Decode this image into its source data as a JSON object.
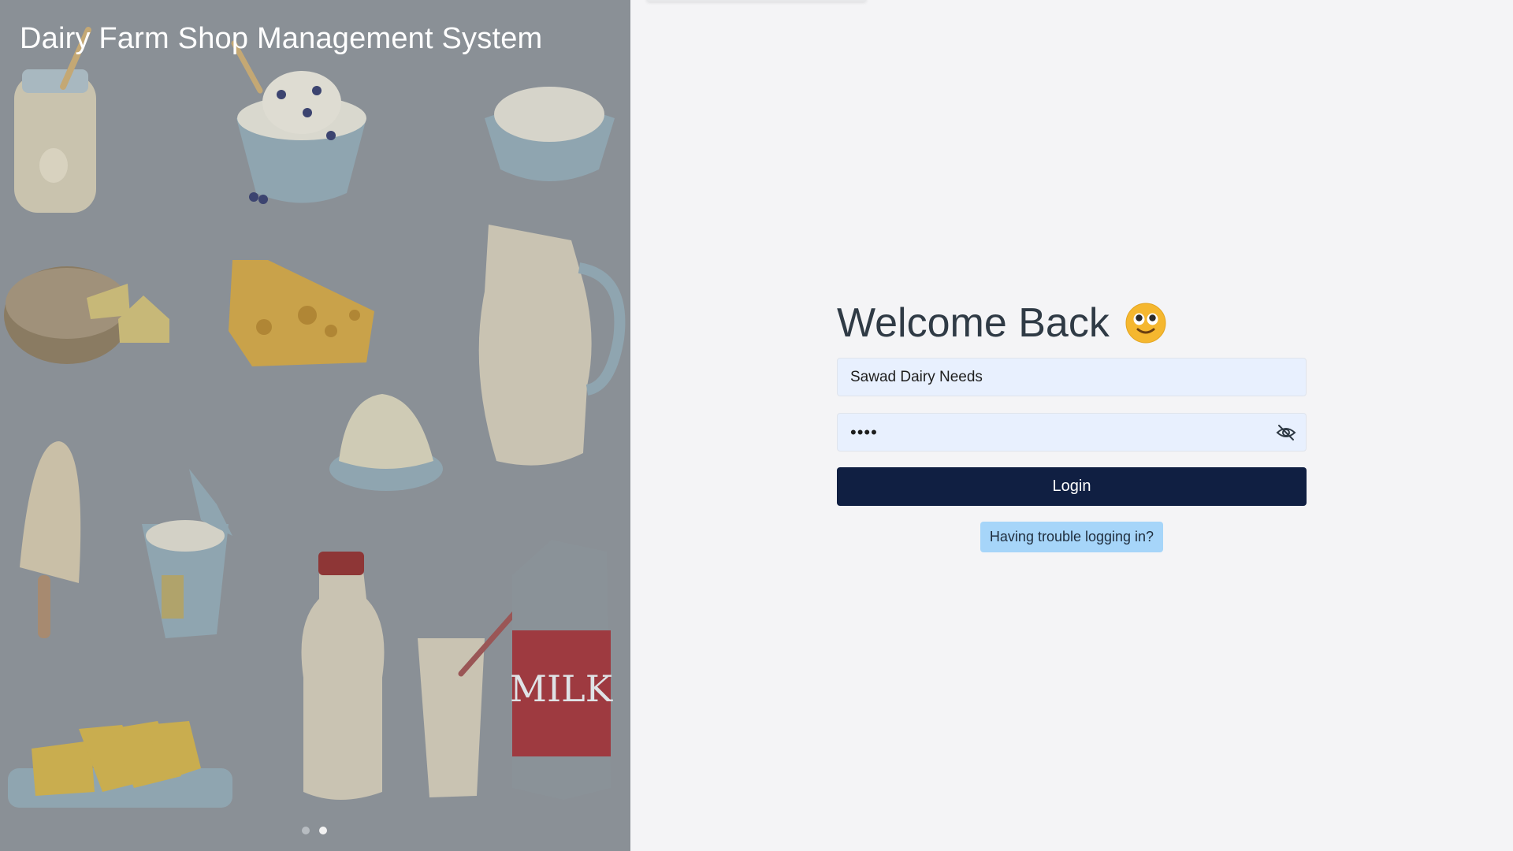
{
  "hero": {
    "title": "Dairy Farm Shop Management System",
    "carousel": {
      "slides": 2,
      "active_index": 1
    },
    "illustration": "dairy-products",
    "milk_carton_label": "MILK"
  },
  "login": {
    "heading": "Welcome Back",
    "heading_icon": "smiley-face-icon",
    "username_value": "Sawad Dairy Needs",
    "password_value": "test",
    "password_toggle_icon": "eye-off-icon",
    "login_label": "Login",
    "help_label": "Having trouble logging in?"
  },
  "colors": {
    "primary_button": "#101f42",
    "help_button": "#a6d5f9",
    "input_bg": "#e8f0fe",
    "page_bg": "#f4f4f6"
  }
}
